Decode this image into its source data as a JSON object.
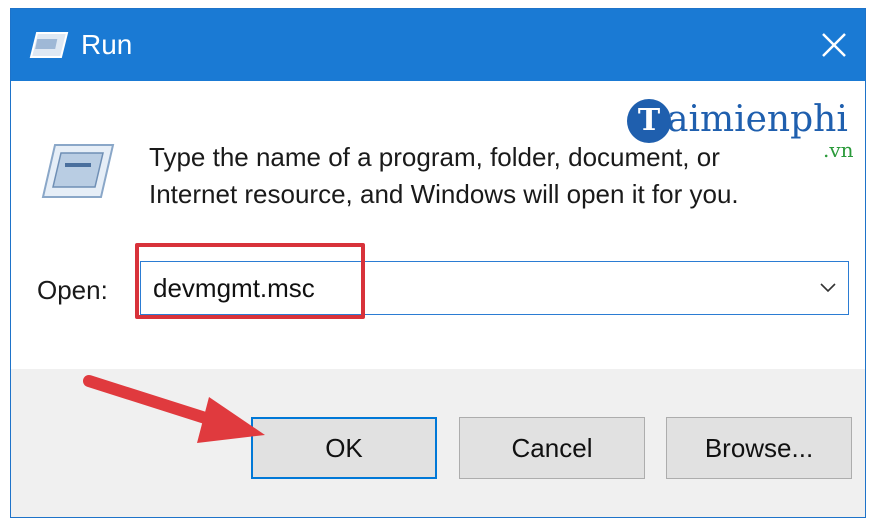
{
  "window": {
    "title": "Run",
    "icons": {
      "title_icon": "run-app-icon",
      "close_icon": "close-icon",
      "run_icon": "run-app-icon",
      "dropdown_icon": "chevron-down-icon"
    }
  },
  "branding": {
    "logo_initial": "T",
    "logo_name": "aimienphi",
    "logo_tld": ".vn"
  },
  "description": {
    "line1": "Type the name of a program, folder, document, or",
    "line2": "Internet resource, and Windows will open it for you."
  },
  "open_field": {
    "label": "Open:",
    "value": "devmgmt.msc"
  },
  "buttons": {
    "ok": "OK",
    "cancel": "Cancel",
    "browse": "Browse..."
  },
  "colors": {
    "titlebar": "#1a7ad4",
    "accent": "#0078d7",
    "highlight": "#d8323a",
    "footer": "#f0f0f0"
  }
}
